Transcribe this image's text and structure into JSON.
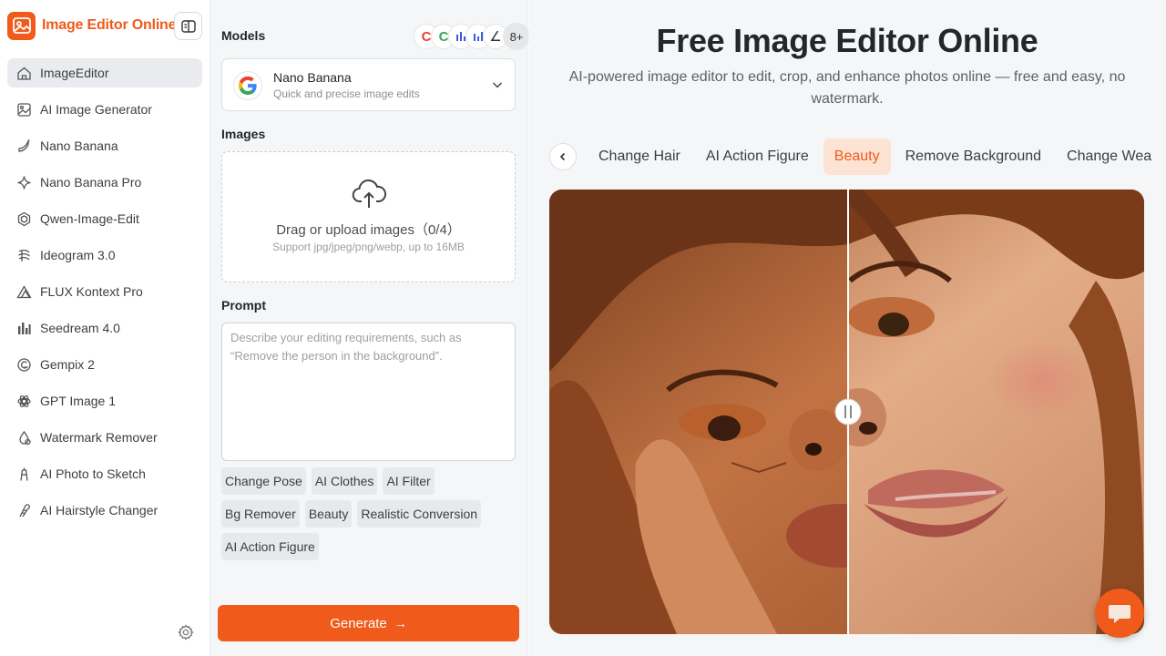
{
  "brand": {
    "name": "Image Editor Online"
  },
  "sidebar": {
    "items": [
      {
        "label": "ImageEditor",
        "icon": "home-icon",
        "active": true
      },
      {
        "label": "AI Image Generator",
        "icon": "image-icon"
      },
      {
        "label": "Nano Banana",
        "icon": "banana-icon"
      },
      {
        "label": "Nano Banana Pro",
        "icon": "sparkle-icon"
      },
      {
        "label": "Qwen-Image-Edit",
        "icon": "qwen-icon"
      },
      {
        "label": "Ideogram 3.0",
        "icon": "ideogram-icon"
      },
      {
        "label": "FLUX Kontext Pro",
        "icon": "flux-icon"
      },
      {
        "label": "Seedream 4.0",
        "icon": "bars-icon"
      },
      {
        "label": "Gempix 2",
        "icon": "gempix-icon"
      },
      {
        "label": "GPT Image 1",
        "icon": "openai-icon"
      },
      {
        "label": "Watermark Remover",
        "icon": "watermark-icon"
      },
      {
        "label": "AI Photo to Sketch",
        "icon": "sketch-icon"
      },
      {
        "label": "AI Hairstyle Changer",
        "icon": "hairstyle-icon"
      }
    ]
  },
  "panel": {
    "models_label": "Models",
    "models_more": "8+",
    "model": {
      "name": "Nano Banana",
      "desc": "Quick and precise image edits"
    },
    "images_label": "Images",
    "upload_title": "Drag or upload images（0/4）",
    "upload_sub": "Support jpg/jpeg/png/webp, up to 16MB",
    "prompt_label": "Prompt",
    "prompt_placeholder": "Describe your editing requirements, such as “Remove the person in the background”.",
    "chips": [
      "Change Pose",
      "AI Clothes",
      "AI Filter",
      "Bg Remover",
      "Beauty",
      "Realistic Conversion",
      "AI Action Figure"
    ],
    "generate_label": "Generate"
  },
  "main": {
    "title": "Free Image Editor Online",
    "subtitle": "AI-powered image editor to edit, crop, and enhance photos online — free and easy, no watermark.",
    "tabs": [
      {
        "label": "Change Hair"
      },
      {
        "label": "AI Action Figure"
      },
      {
        "label": "Beauty",
        "active": true
      },
      {
        "label": "Remove Background"
      },
      {
        "label": "Change Wea"
      }
    ]
  },
  "colors": {
    "accent": "#f05a1a",
    "active_tab_bg": "#fde3d4"
  }
}
